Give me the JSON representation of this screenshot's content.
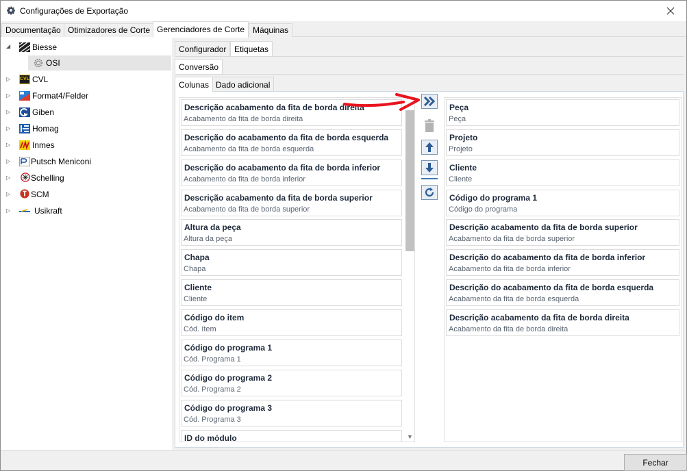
{
  "window": {
    "title": "Configurações de Exportação"
  },
  "top_tabs": [
    "Documentação",
    "Otimizadores de Corte",
    "Gerenciadores de Corte",
    "Máquinas"
  ],
  "tree": {
    "items": [
      {
        "label": "Biesse",
        "expanded": true
      },
      {
        "label": "OSI",
        "child": true
      },
      {
        "label": "CVL"
      },
      {
        "label": "Format4/Felder"
      },
      {
        "label": "Giben"
      },
      {
        "label": "Homag"
      },
      {
        "label": "Inmes"
      },
      {
        "label": "Putsch Meniconi"
      },
      {
        "label": "Schelling"
      },
      {
        "label": "SCM"
      },
      {
        "label": "Usikraft"
      }
    ],
    "logo_text": {
      "cvl": "CVL"
    }
  },
  "sub_tabs": [
    "Configurador",
    "Etiquetas"
  ],
  "conversion_tab": "Conversão",
  "inner_tabs": [
    "Colunas",
    "Dado adicional"
  ],
  "available_columns": [
    {
      "title": "Descrição acabamento da fita de borda direita",
      "sub": "Acabamento da fita de borda direita"
    },
    {
      "title": "Descrição do acabamento da fita de borda esquerda",
      "sub": "Acabamento da fita de borda esquerda"
    },
    {
      "title": "Descrição do acabamento da fita de borda inferior",
      "sub": "Acabamento da fita de borda inferior"
    },
    {
      "title": "Descrição acabamento da fita de borda superior",
      "sub": "Acabamento da fita de borda superior"
    },
    {
      "title": "Altura da peça",
      "sub": "Altura da peça"
    },
    {
      "title": "Chapa",
      "sub": "Chapa"
    },
    {
      "title": "Cliente",
      "sub": "Cliente"
    },
    {
      "title": "Código do item",
      "sub": "Cód. Item"
    },
    {
      "title": "Código do programa 1",
      "sub": "Cód. Programa 1"
    },
    {
      "title": "Código do programa 2",
      "sub": "Cód. Programa 2"
    },
    {
      "title": "Código do programa 3",
      "sub": "Cód. Programa 3"
    },
    {
      "title": "ID do módulo",
      "sub": ""
    }
  ],
  "selected_columns": [
    {
      "title": "Peça",
      "sub": "Peça"
    },
    {
      "title": "Projeto",
      "sub": "Projeto"
    },
    {
      "title": "Cliente",
      "sub": "Cliente"
    },
    {
      "title": "Código do programa 1",
      "sub": "Código do programa"
    },
    {
      "title": "Descrição acabamento da fita de borda superior",
      "sub": "Acabamento da fita de borda superior"
    },
    {
      "title": "Descrição do acabamento da fita de borda inferior",
      "sub": "Acabamento da fita de borda inferior"
    },
    {
      "title": "Descrição do acabamento da fita de borda esquerda",
      "sub": "Acabamento da fita de borda esquerda"
    },
    {
      "title": "Descrição acabamento da fita de borda direita",
      "sub": "Acabamento da fita de borda direita"
    }
  ],
  "toolbar": {
    "icons": [
      "move-all-right-icon",
      "trash-icon",
      "arrow-up-icon",
      "arrow-down-icon",
      "refresh-icon"
    ]
  },
  "footer": {
    "close_label": "Fechar"
  },
  "colors": {
    "accent_blue": "#3c78b4",
    "annotation_red": "#e8141e"
  }
}
